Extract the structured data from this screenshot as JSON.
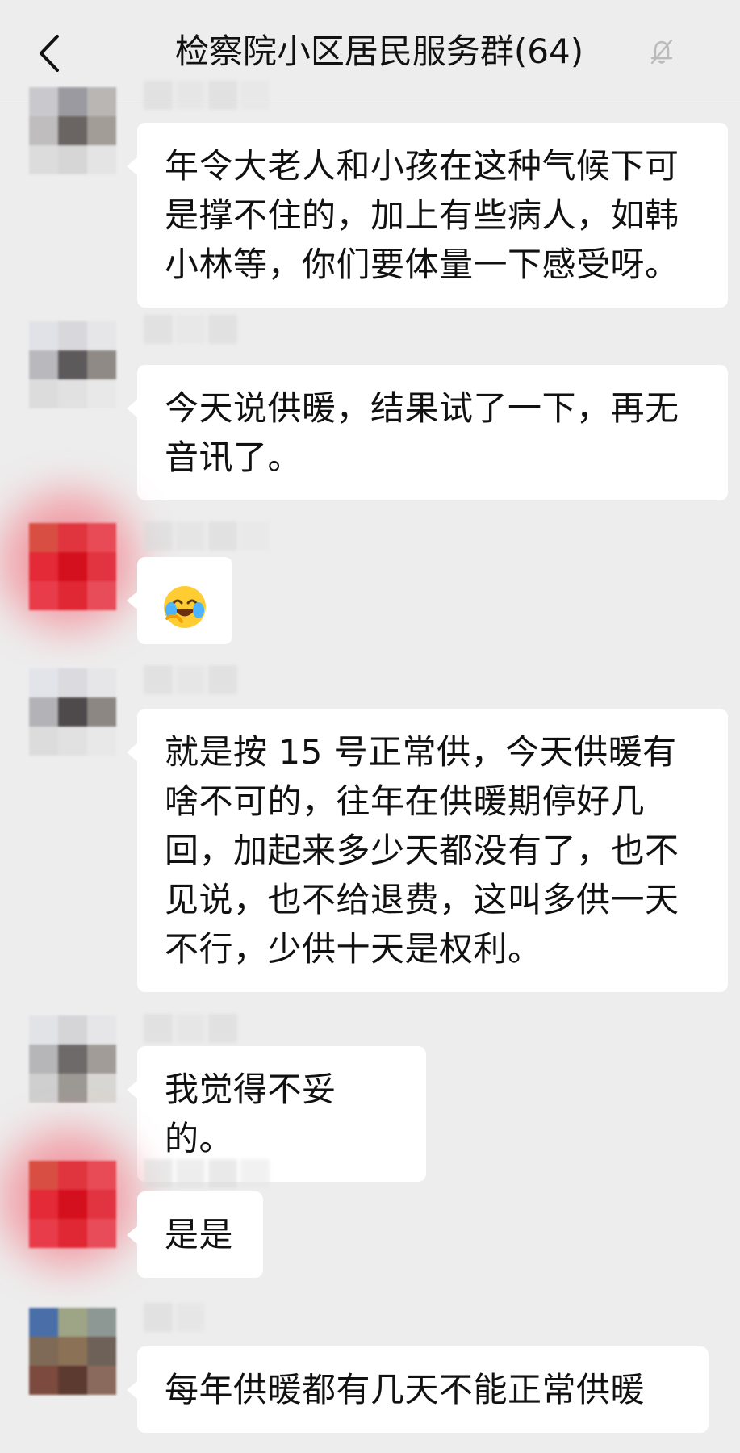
{
  "header": {
    "title": "检察院小区居民服务群(64)",
    "back_icon": "chevron-left-icon",
    "mute_icon": "bell-off-icon"
  },
  "messages": [
    {
      "text": "年令大老人和小孩在这种气候下可是撑不住的，加上有些病人，如韩小林等，你们要体量一下感受呀。"
    },
    {
      "text": "今天说供暖，结果试了一下，再无音讯了。"
    },
    {
      "emoji": "face-with-tears-of-joy-emoji"
    },
    {
      "text": "就是按 15 号正常供，今天供暖有啥不可的，往年在供暖期停好几回，加起来多少天都没有了，也不见说，也不给退费，这叫多供一天不行，少供十天是权利。"
    },
    {
      "text": "我觉得不妥的。"
    },
    {
      "text": "是是"
    },
    {
      "text": "每年供暖都有几天不能正常供暖"
    }
  ],
  "colors": {
    "background": "#ededed",
    "bubble": "#ffffff",
    "text": "#111111"
  }
}
